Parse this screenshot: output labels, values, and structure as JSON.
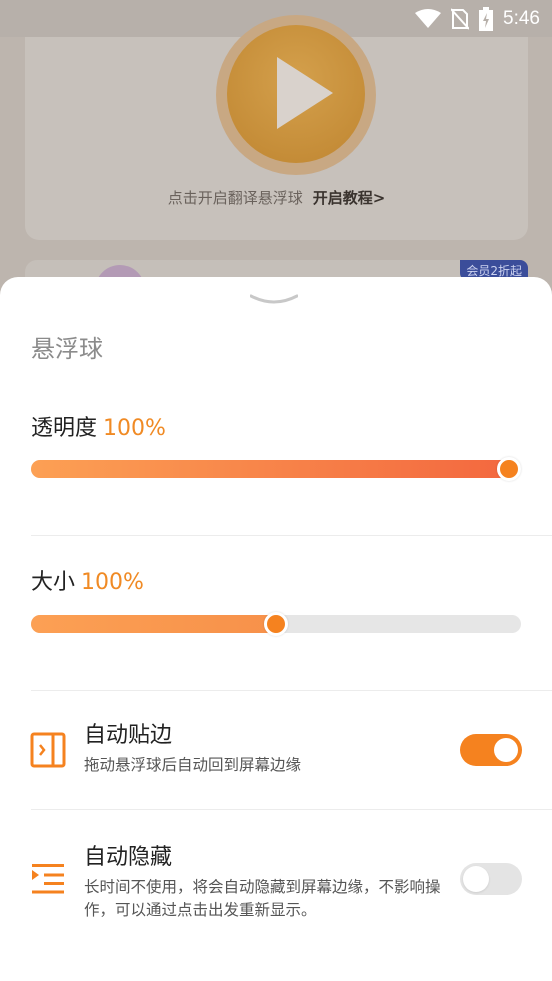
{
  "status_bar": {
    "time": "5:46"
  },
  "background": {
    "caption": "点击开启翻译悬浮球",
    "tutorial_link": "开启教程>",
    "promo_badge": "会员2折起"
  },
  "sheet": {
    "title": "悬浮球",
    "opacity": {
      "label": "透明度",
      "value_text": "100%",
      "value": 1.0
    },
    "size": {
      "label": "大小",
      "value_text": "100%",
      "value": 0.5
    },
    "auto_snap": {
      "title": "自动贴边",
      "description": "拖动悬浮球后自动回到屏幕边缘",
      "icon": "snap-edge-icon",
      "enabled": true
    },
    "auto_hide": {
      "title": "自动隐藏",
      "description": "长时间不使用，将会自动隐藏到屏幕边缘，不影响操作，可以通过点击出发重新显示。",
      "icon": "hide-list-icon",
      "enabled": false
    }
  },
  "colors": {
    "accent": "#f5821f",
    "gradient_start": "#fca054",
    "gradient_end": "#f3683f"
  }
}
